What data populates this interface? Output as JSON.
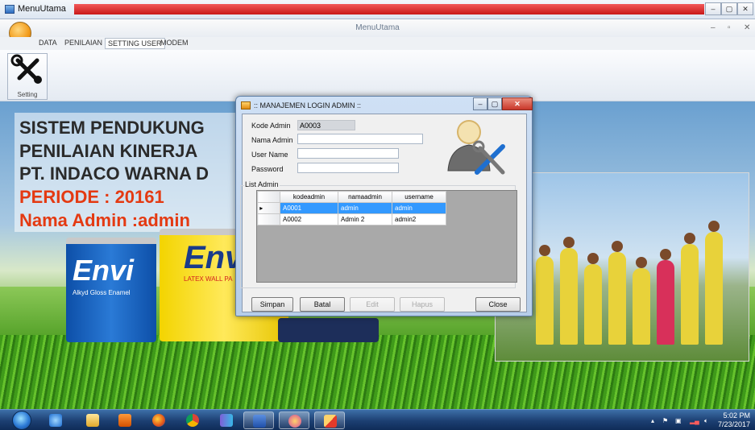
{
  "os_window": {
    "title": "MenuUtama",
    "controls": [
      "–",
      "▢",
      "✕"
    ]
  },
  "app": {
    "center_title": "MenuUtama",
    "window_controls": [
      "–",
      "▫",
      "✕"
    ],
    "menu_tabs": [
      "DATA",
      "PENILAIAN",
      "SETTING USER",
      "MODEM"
    ],
    "active_tab": "SETTING USER",
    "toolbar": {
      "setting_label": "Setting"
    }
  },
  "poster": {
    "line1": "SISTEM PENDUKUNG",
    "line2": "PENILAIAN KINERJA",
    "line3": "PT. INDACO WARNA D",
    "line4": "PERIODE : 20161",
    "line5": "Nama Admin :admin",
    "can1_brand": "Envi",
    "can1_sub": "Alkyd Gloss Enamel",
    "can2_brand": "Env",
    "can2_sub": "LATEX WALL PA"
  },
  "dialog": {
    "title": ":: MANAJEMEN LOGIN ADMIN ::",
    "fields": {
      "kode_label": "Kode Admin",
      "kode_value": "A0003",
      "nama_label": "Nama Admin",
      "nama_value": "",
      "user_label": "User Name",
      "user_value": "",
      "pass_label": "Password",
      "pass_value": ""
    },
    "list_label": "List Admin",
    "grid": {
      "columns": [
        "kodeadmin",
        "namaadmin",
        "username"
      ],
      "rows": [
        [
          "A0001",
          "admin",
          "admin"
        ],
        [
          "A0002",
          "Admin 2",
          "admin2"
        ]
      ],
      "selected_row": 0
    },
    "buttons": {
      "simpan": "Simpan",
      "batal": "Batal",
      "edit": "Edit",
      "hapus": "Hapus",
      "close": "Close"
    }
  },
  "taskbar": {
    "time": "5:02 PM",
    "date": "7/23/2017"
  },
  "colors": {
    "selection": "#3399ff",
    "poster_accent": "#e43a12",
    "taskbar": "#1c3f72"
  }
}
